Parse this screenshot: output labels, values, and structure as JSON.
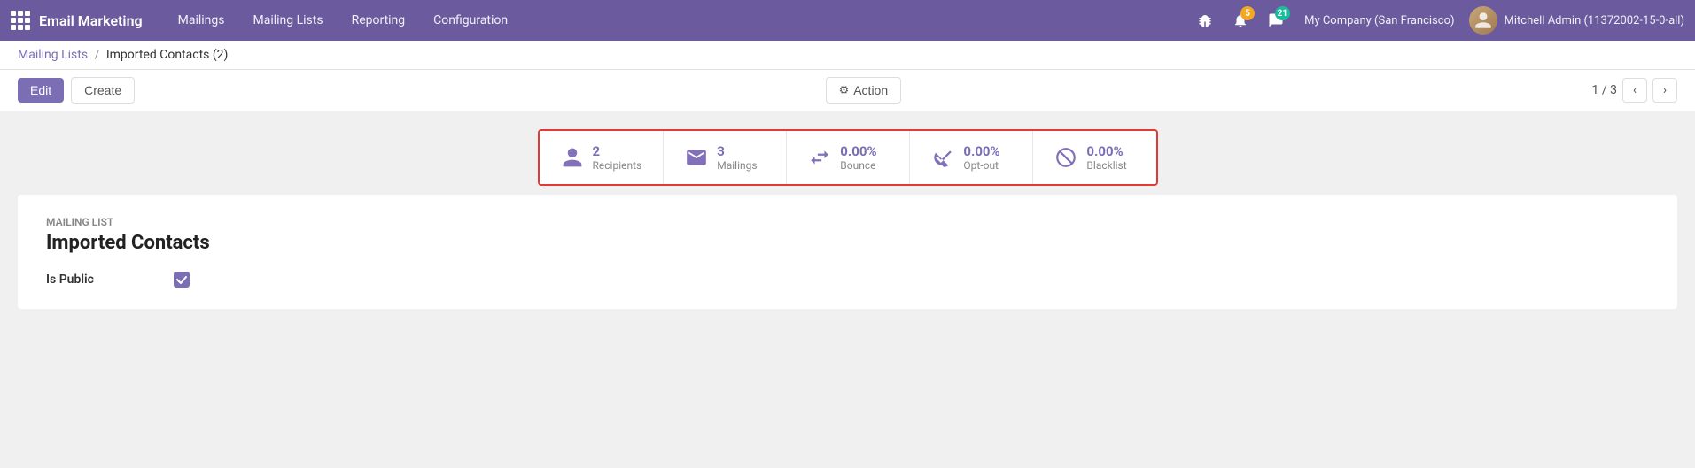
{
  "topnav": {
    "app_name": "Email Marketing",
    "menu_items": [
      "Mailings",
      "Mailing Lists",
      "Reporting",
      "Configuration"
    ],
    "company": "My Company (San Francisco)",
    "username": "Mitchell Admin (11372002-15-0-all)",
    "badge_bell": "5",
    "badge_chat": "21"
  },
  "breadcrumb": {
    "parent": "Mailing Lists",
    "separator": "/",
    "current": "Imported Contacts (2)"
  },
  "toolbar": {
    "edit_label": "Edit",
    "create_label": "Create",
    "action_label": "Action",
    "pagination_text": "1 / 3"
  },
  "stats": [
    {
      "id": "recipients",
      "value": "2",
      "label": "Recipients",
      "icon": "person"
    },
    {
      "id": "mailings",
      "value": "3",
      "label": "Mailings",
      "icon": "mail"
    },
    {
      "id": "bounce",
      "value": "0.00%",
      "label": "Bounce",
      "icon": "bounce"
    },
    {
      "id": "optout",
      "value": "0.00%",
      "label": "Opt-out",
      "icon": "optout"
    },
    {
      "id": "blacklist",
      "value": "0.00%",
      "label": "Blacklist",
      "icon": "blacklist"
    }
  ],
  "record": {
    "field_label": "Mailing List",
    "title": "Imported Contacts",
    "is_public_label": "Is Public",
    "is_public_value": true
  },
  "colors": {
    "primary": "#7c6eb5",
    "nav_bg": "#6b5b9e",
    "accent_red": "#e53935"
  }
}
